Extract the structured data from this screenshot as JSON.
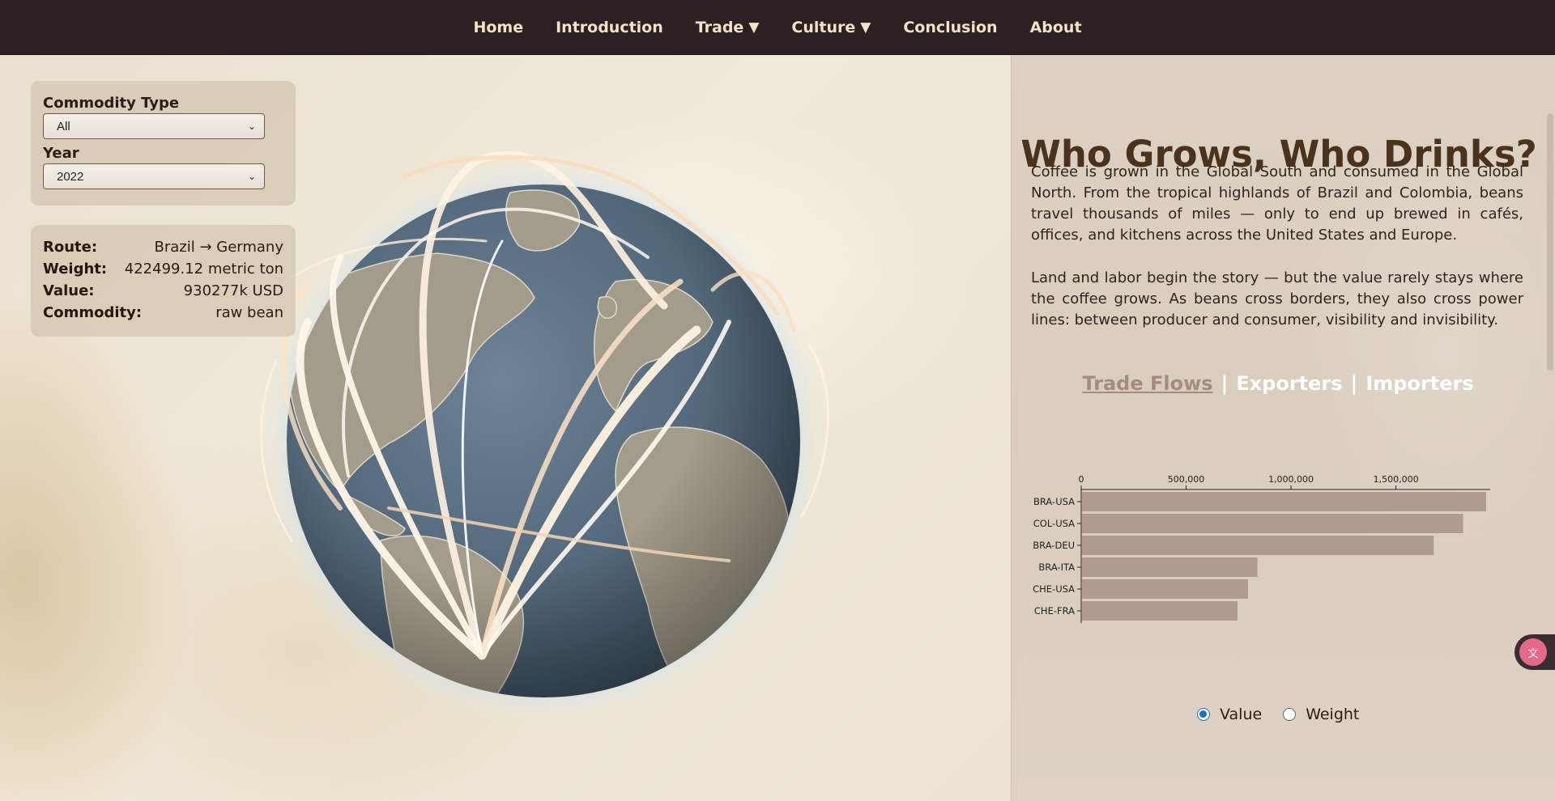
{
  "nav": {
    "items": [
      {
        "label": "Home",
        "caret": ""
      },
      {
        "label": "Introduction",
        "caret": ""
      },
      {
        "label": "Trade",
        "caret": "▼"
      },
      {
        "label": "Culture",
        "caret": "▼"
      },
      {
        "label": "Conclusion",
        "caret": ""
      },
      {
        "label": "About",
        "caret": ""
      }
    ]
  },
  "controls": {
    "commodity_label": "Commodity Type",
    "commodity_value": "All",
    "year_label": "Year",
    "year_value": "2022"
  },
  "tooltip": {
    "route_key": "Route:",
    "route_val": "Brazil → Germany",
    "weight_key": "Weight:",
    "weight_val": "422499.12 metric ton",
    "value_key": "Value:",
    "value_val": "930277k USD",
    "commodity_key": "Commodity:",
    "commodity_val": "raw bean"
  },
  "side": {
    "title": "Who Grows, Who Drinks?",
    "para1": "Coffee is grown in the Global South and consumed in the Global North. From the tropical highlands of Brazil and Colombia, beans travel thousands of miles — only to end up brewed in cafés, offices, and kitchens across the United States and Europe.",
    "para2": "Land and labor begin the story — but the value rarely stays where the coffee grows. As beans cross borders, they also cross power lines: between producer and consumer, visibility and invisibility.",
    "tabs": [
      "Trade Flows",
      "Exporters",
      "Importers"
    ],
    "tab_sep": "|",
    "radio_value": "Value",
    "radio_weight": "Weight"
  },
  "colors": {
    "nav_bg": "#2d2023",
    "nav_text": "#f3e2c4",
    "title": "#4b321c",
    "bar": "#b09c8e",
    "ocean": "#51687a",
    "land": "#a39c8a",
    "arc": "#fff4e4"
  },
  "translate_icon": "translate-icon",
  "chart_data": {
    "type": "bar",
    "orientation": "horizontal",
    "categories": [
      "BRA-USA",
      "COL-USA",
      "BRA-DEU",
      "BRA-ITA",
      "CHE-USA",
      "CHE-FRA"
    ],
    "values": [
      1930000,
      1820000,
      1680000,
      840000,
      795000,
      745000
    ],
    "xticks": [
      0,
      500000,
      1000000,
      1500000
    ],
    "xtick_labels": [
      "0",
      "500,000",
      "1,000,000",
      "1,500,000"
    ],
    "xlim": [
      0,
      1930000
    ],
    "axis_position": "top"
  }
}
